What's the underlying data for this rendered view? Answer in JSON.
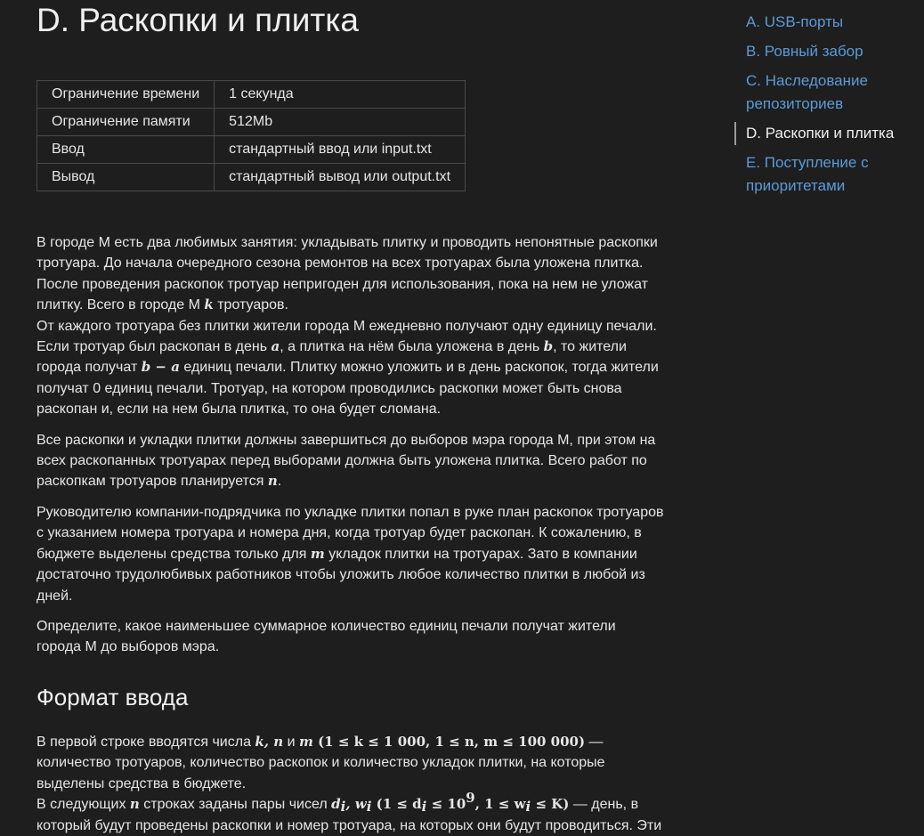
{
  "problem": {
    "title": "D. Раскопки и плитка"
  },
  "limits": [
    {
      "key": "Ограничение времени",
      "value": "1 секунда"
    },
    {
      "key": "Ограничение памяти",
      "value": "512Mb"
    },
    {
      "key": "Ввод",
      "value": "стандартный ввод или input.txt"
    },
    {
      "key": "Вывод",
      "value": "стандартный вывод или output.txt"
    }
  ],
  "statement": {
    "p1": {
      "t1": "В городе М есть два любимых занятия: укладывать плитку и проводить непонятные раскопки тротуара. До начала очередного сезона ремонтов на всех тротуарах была уложена плитка. После проведения раскопок тротуар непригоден для использования, пока на нем не уложат плитку. Всего в городе М ",
      "k": "k",
      "t2": " тротуаров.",
      "t3": "От каждого тротуара без плитки жители города М ежедневно получают одну единицу печали. Если тротуар был раскопан в день ",
      "a": "a",
      "t4": ", а плитка на нём была уложена в день ",
      "b": "b",
      "t5": ", то жители города получат ",
      "ba": "b − a",
      "t6": " единиц печали. Плитку можно уложить и в день раскопок, тогда жители получат 0 единиц печали. Тротуар, на котором проводились раскопки может быть снова раскопан и, если на нем была плитка, то она будет сломана."
    },
    "p2": {
      "t1": "Все раскопки и укладки плитки должны завершиться до выборов мэра города М, при этом на всех раскопанных тротуарах перед выборами должна быть уложена плитка. Всего работ по раскопкам тротуаров планируется ",
      "n": "n",
      "t2": "."
    },
    "p3": {
      "t1": "Руководителю компании-подрядчика по укладке плитки попал в руке план раскопок тротуаров с указанием номера тротуара и номера дня, когда тротуар будет раскопан. К сожалению, в бюджете выделены средства только для ",
      "m": "m",
      "t2": " укладок плитки на тротуарах. Зато в компании достаточно трудолюбивых работников чтобы уложить любое количество плитки в любой из дней."
    },
    "p4": "Определите, какое наименьшее суммарное количество единиц печали получат жители города М до выборов мэра."
  },
  "input_format": {
    "heading": "Формат ввода",
    "l1_t1": "В первой строке вводятся числа ",
    "l1_m1": "k, n",
    "l1_t2": " и ",
    "l1_m2": "m",
    "l1_m3": " (1 ≤ k ≤ 1 000, 1 ≤ n, m ≤ 100 000)",
    "l1_t3": " — количество тротуаров, количество раскопок и количество укладок плитки, на которые выделены средства в бюджете.",
    "l2_t1": "В следующих ",
    "l2_n": "n",
    "l2_t2": " строках заданы пары чисел ",
    "l2_d": "d",
    "l2_i1": "i",
    "l2_comma": ", w",
    "l2_i2": "i",
    "l2_open": " (1 ≤ d",
    "l2_i3": "i",
    "l2_le": " ≤ 10",
    "l2_exp": "9",
    "l2_mid": ", 1 ≤ w",
    "l2_i4": "i",
    "l2_close": " ≤ K)",
    "l2_t3": " — день, в который будут проведены раскопки и номер тротуара, на которых они будут проводиться. Эти"
  },
  "toc": [
    {
      "label": "A. USB-порты",
      "active": false
    },
    {
      "label": "B. Ровный забор",
      "active": false
    },
    {
      "label": "C. Наследование репозиториев",
      "active": false
    },
    {
      "label": "D. Раскопки и плитка",
      "active": true
    },
    {
      "label": "E. Поступление с приоритетами",
      "active": false
    }
  ],
  "colors": {
    "background": "#1e1e1f",
    "text": "#e6e6e6",
    "link": "#5b9bd5",
    "table_border": "#4a4a4c"
  }
}
